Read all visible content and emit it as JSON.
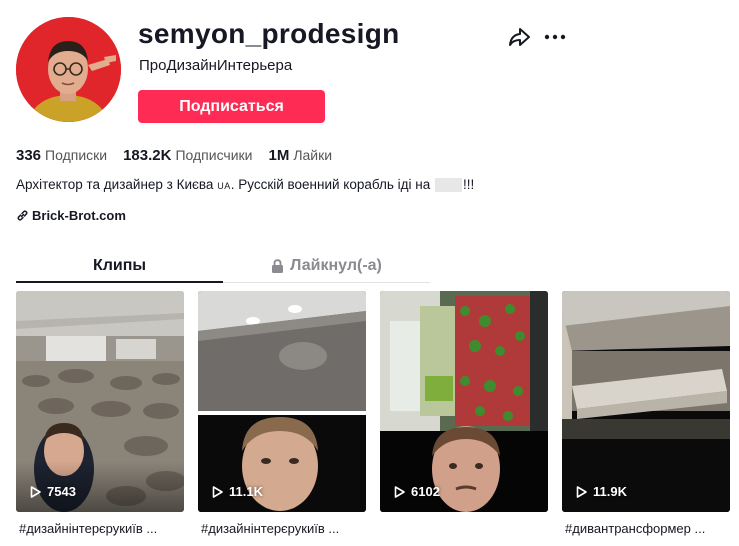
{
  "profile": {
    "username": "semyon_prodesign",
    "nickname": "ПроДизайнИнтерьера",
    "follow_label": "Подписаться",
    "stats": [
      {
        "value": "336",
        "label": "Подписки"
      },
      {
        "value": "183.2K",
        "label": "Подписчики"
      },
      {
        "value": "1M",
        "label": "Лайки"
      }
    ],
    "bio_part1": "Архітектор та дизайнер з Києва",
    "bio_flag": "UA",
    "bio_part2": ". Русскій военний корабль іді на",
    "bio_part3": "!!!",
    "link": "Brick-Brot.com"
  },
  "tabs": [
    {
      "label": "Клипы"
    },
    {
      "label": "Лайкнул(-а)"
    }
  ],
  "videos": [
    {
      "views": "7543",
      "caption": "#дизайнінтерєрукиїв ..."
    },
    {
      "views": "11.1K",
      "caption": "#дизайнінтерєрукиїв ..."
    },
    {
      "views": "6102",
      "caption": ""
    },
    {
      "views": "11.9K",
      "caption": "#дивантрансформер ..."
    }
  ],
  "colors": {
    "accent": "#fe2c55",
    "text": "#161823",
    "muted": "#8a8b91",
    "avatar_bg": "#e0262a"
  },
  "icons": [
    "share-icon",
    "more-icon",
    "link-icon",
    "lock-icon",
    "play-icon"
  ]
}
